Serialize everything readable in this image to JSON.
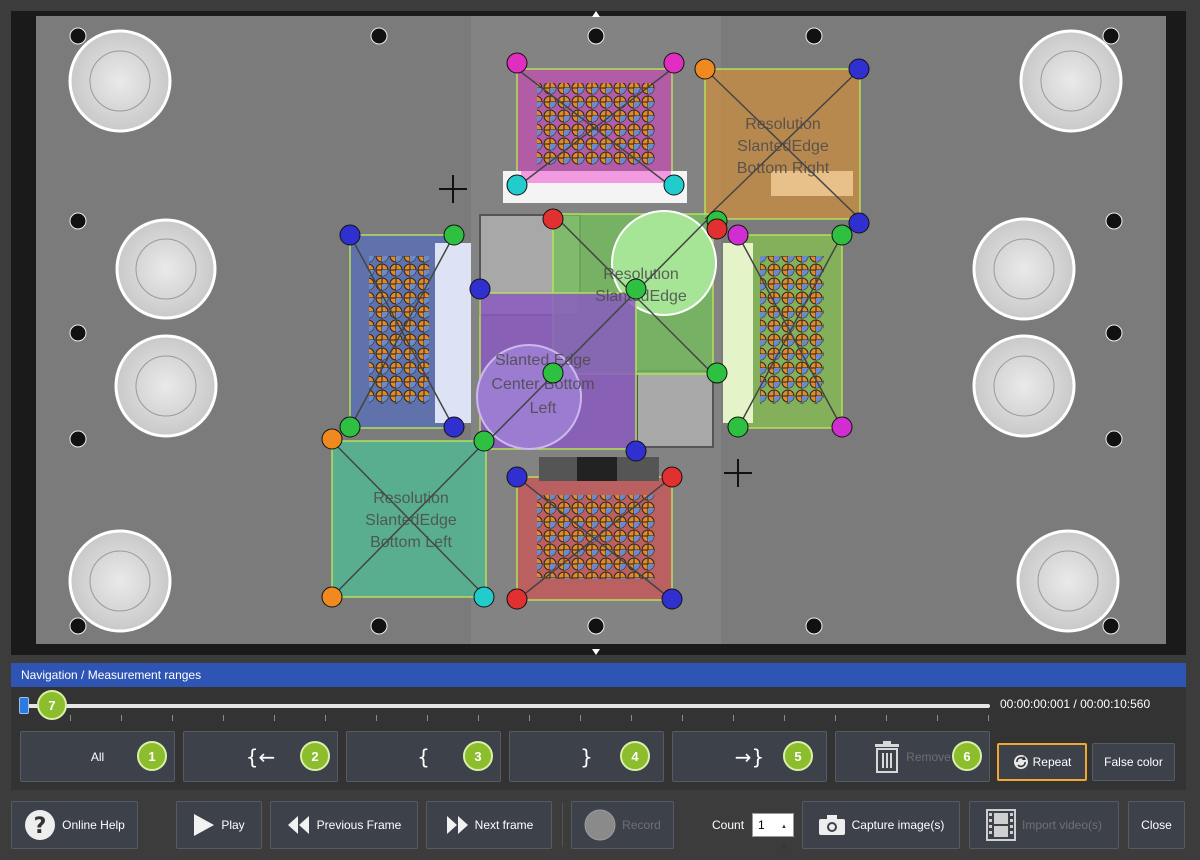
{
  "navigation": {
    "header": "Navigation / Measurement ranges",
    "time_readout": "00:00:00:001 / 00:00:10:560",
    "slider_badge": "7",
    "range_buttons": [
      {
        "label": "All",
        "badge": "1"
      },
      {
        "label": "{←",
        "badge": "2"
      },
      {
        "label": "{",
        "badge": "3"
      },
      {
        "label": "}",
        "badge": "4"
      },
      {
        "label": "→}",
        "badge": "5"
      },
      {
        "label": "Remove",
        "badge": "6"
      }
    ],
    "repeat_label": "Repeat",
    "false_color_label": "False color"
  },
  "chart_overlay_labels": {
    "top_right": [
      "Resolution",
      "SlantedEdge",
      "Bottom Right"
    ],
    "center": [
      "Resolution",
      "SlantedEdge"
    ],
    "center_left": [
      "Slanted Edge",
      "Center Bottom",
      "Left"
    ],
    "bottom_left": [
      "Resolution",
      "SlantedEdge",
      "Bottom Left"
    ]
  },
  "toolbar": {
    "help_label": "Online Help",
    "play_label": "Play",
    "prev_label": "Previous Frame",
    "next_label": "Next frame",
    "record_label": "Record",
    "count_label": "Count",
    "count_value": "1",
    "capture_label": "Capture image(s)",
    "import_label": "Import video(s)",
    "close_label": "Close"
  },
  "colors": {
    "accent_blue": "#2f55b4",
    "badge_green": "#8bbd2c",
    "active_orange": "#f0a830"
  }
}
